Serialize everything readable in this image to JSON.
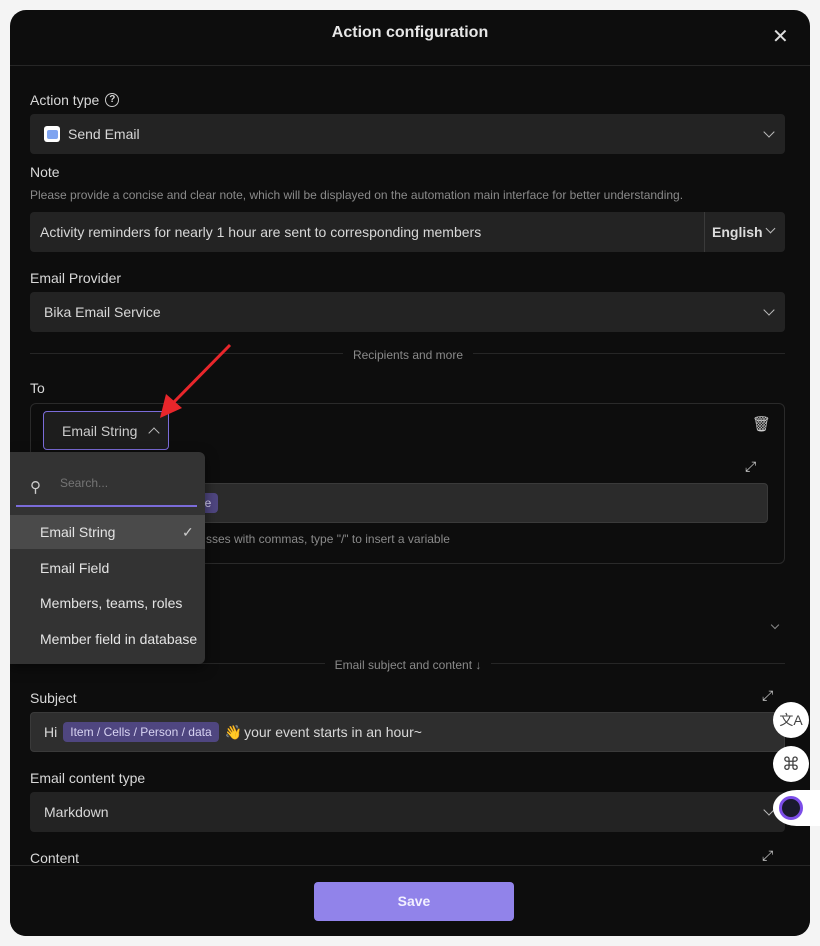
{
  "header": {
    "title": "Action configuration",
    "close_icon": "close-icon"
  },
  "action_type": {
    "label": "Action type",
    "value": "Send Email",
    "icon": "email-icon"
  },
  "note": {
    "label": "Note",
    "help": "Please provide a concise and clear note, which will be displayed on the automation main interface for better understanding.",
    "value": "Activity reminders for nearly 1 hour are sent to corresponding members",
    "language": "English"
  },
  "email_provider": {
    "label": "Email Provider",
    "value": "Bika Email Service"
  },
  "recipients_divider": "Recipients and more",
  "to": {
    "label": "To",
    "type_button": "Email String",
    "chip_visible": "ue",
    "helper_visible": "sses with commas, type \"/\" to insert a variable"
  },
  "dropdown": {
    "search_placeholder": "Search...",
    "items": [
      {
        "label": "Email String",
        "selected": true
      },
      {
        "label": "Email Field"
      },
      {
        "label": "Members, teams, roles"
      },
      {
        "label": "Member field in database"
      }
    ]
  },
  "subject_divider": "Email subject and content ↓",
  "subject": {
    "label": "Subject",
    "prefix": "Hi",
    "chip": "Item / Cells / Person / data",
    "emoji": "👋",
    "suffix": "your event starts in an hour~"
  },
  "content_type": {
    "label": "Email content type",
    "value": "Markdown"
  },
  "content": {
    "label": "Content"
  },
  "footer": {
    "save_label": "Save"
  },
  "colors": {
    "accent": "#9183ea",
    "modal_bg": "#0d0d0d",
    "field_bg": "#232323",
    "chip_bg": "#4f4680",
    "arrow": "#e8262b"
  }
}
